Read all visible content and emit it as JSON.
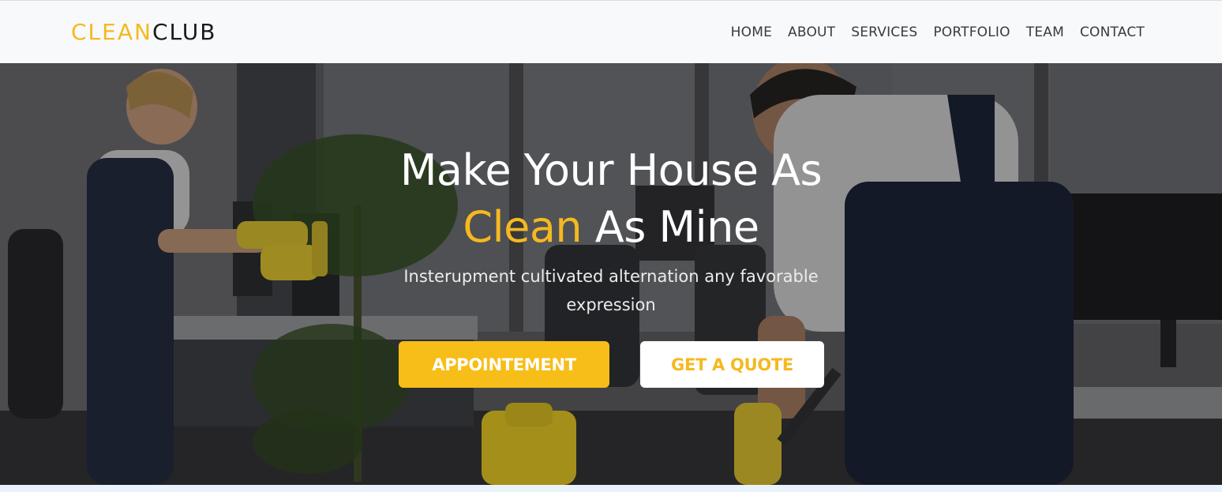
{
  "brand": {
    "part1": "CLEAN",
    "part2": "CLUB"
  },
  "nav": {
    "items": [
      "HOME",
      "ABOUT",
      "SERVICES",
      "PORTFOLIO",
      "TEAM",
      "CONTACT"
    ]
  },
  "hero": {
    "title_line1": "Make Your House As",
    "title_accent": "Clean",
    "title_line2_rest": " As Mine",
    "subtitle": "Insterupment cultivated alternation any favorable expression",
    "primary_button": "APPOINTEMENT",
    "secondary_button": "GET A QUOTE"
  },
  "colors": {
    "accent": "#f5b91f",
    "nav_text": "#3a3a3a",
    "navbar_bg": "#f8f9fb"
  }
}
